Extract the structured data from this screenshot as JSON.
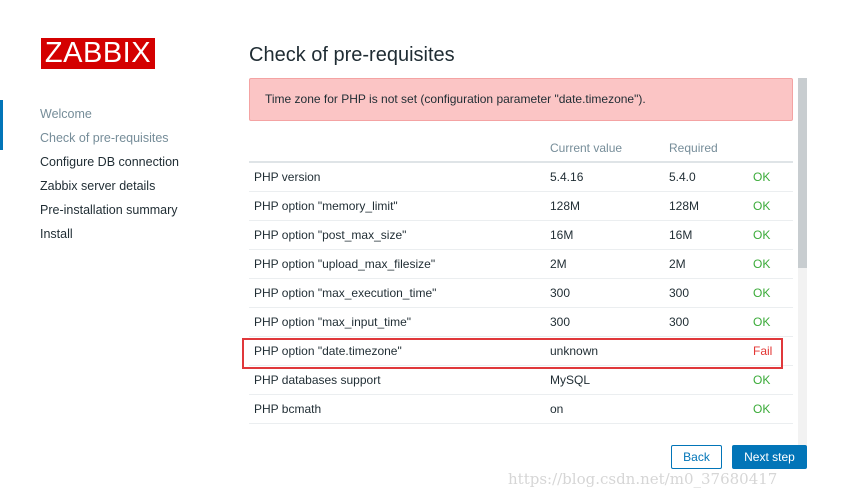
{
  "logo": {
    "text": "ZABBIX"
  },
  "sidebar": {
    "items": [
      {
        "label": "Welcome",
        "state": "done"
      },
      {
        "label": "Check of pre-requisites",
        "state": "current"
      },
      {
        "label": "Configure DB connection",
        "state": "pending"
      },
      {
        "label": "Zabbix server details",
        "state": "pending"
      },
      {
        "label": "Pre-installation summary",
        "state": "pending"
      },
      {
        "label": "Install",
        "state": "pending"
      }
    ]
  },
  "main": {
    "title": "Check of pre-requisites",
    "error_message": "Time zone for PHP is not set (configuration parameter \"date.timezone\").",
    "table": {
      "columns": [
        "",
        "Current value",
        "Required",
        ""
      ],
      "rows": [
        {
          "name": "PHP version",
          "current": "5.4.16",
          "required": "5.4.0",
          "status": "OK"
        },
        {
          "name": "PHP option \"memory_limit\"",
          "current": "128M",
          "required": "128M",
          "status": "OK"
        },
        {
          "name": "PHP option \"post_max_size\"",
          "current": "16M",
          "required": "16M",
          "status": "OK"
        },
        {
          "name": "PHP option \"upload_max_filesize\"",
          "current": "2M",
          "required": "2M",
          "status": "OK"
        },
        {
          "name": "PHP option \"max_execution_time\"",
          "current": "300",
          "required": "300",
          "status": "OK"
        },
        {
          "name": "PHP option \"max_input_time\"",
          "current": "300",
          "required": "300",
          "status": "OK"
        },
        {
          "name": "PHP option \"date.timezone\"",
          "current": "unknown",
          "required": "",
          "status": "Fail"
        },
        {
          "name": "PHP databases support",
          "current": "MySQL",
          "required": "",
          "status": "OK"
        },
        {
          "name": "PHP bcmath",
          "current": "on",
          "required": "",
          "status": "OK"
        }
      ]
    }
  },
  "buttons": {
    "back": "Back",
    "next": "Next step"
  },
  "watermark": "https://blog.csdn.net/m0_37680417",
  "colors": {
    "brand_red": "#d40000",
    "accent_blue": "#0275b8",
    "ok_green": "#3bab39",
    "fail_red": "#e33734",
    "error_bg": "#fbc5c5"
  }
}
